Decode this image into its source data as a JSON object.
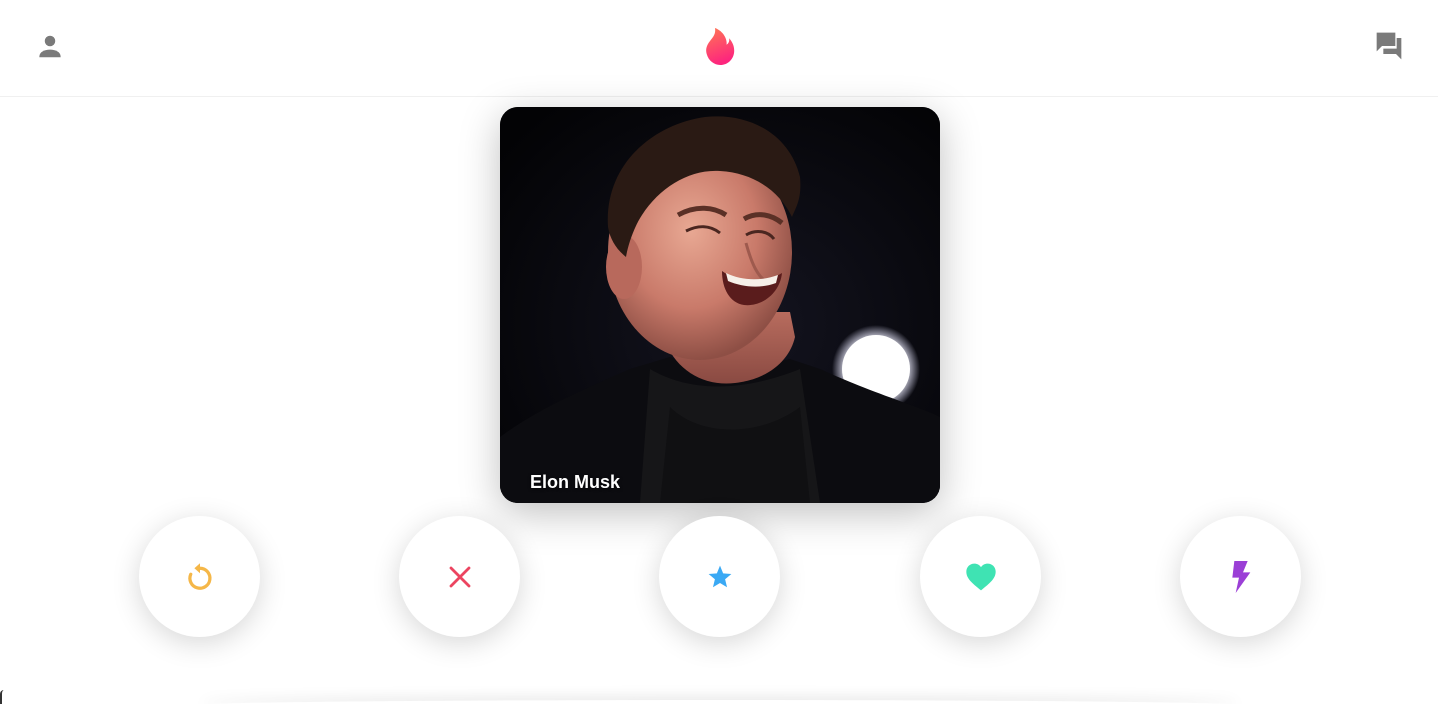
{
  "header": {
    "profile_icon": "person-icon",
    "logo_icon": "flame-logo-icon",
    "messages_icon": "chat-bubbles-icon"
  },
  "card": {
    "name": "Elon Musk"
  },
  "actions": [
    {
      "id": "rewind",
      "icon": "rewind-icon",
      "color": "#F5B748"
    },
    {
      "id": "nope",
      "icon": "close-icon",
      "color": "#EC4460"
    },
    {
      "id": "super-like",
      "icon": "star-icon",
      "color": "#3AA9F4"
    },
    {
      "id": "like",
      "icon": "heart-icon",
      "color": "#3FE3B3"
    },
    {
      "id": "boost",
      "icon": "lightning-icon",
      "color": "#9B3FD6"
    }
  ],
  "colors": {
    "brand_gradient_start": "#FF7854",
    "brand_gradient_end": "#FD267D",
    "header_icon": "#7A7A7A"
  }
}
